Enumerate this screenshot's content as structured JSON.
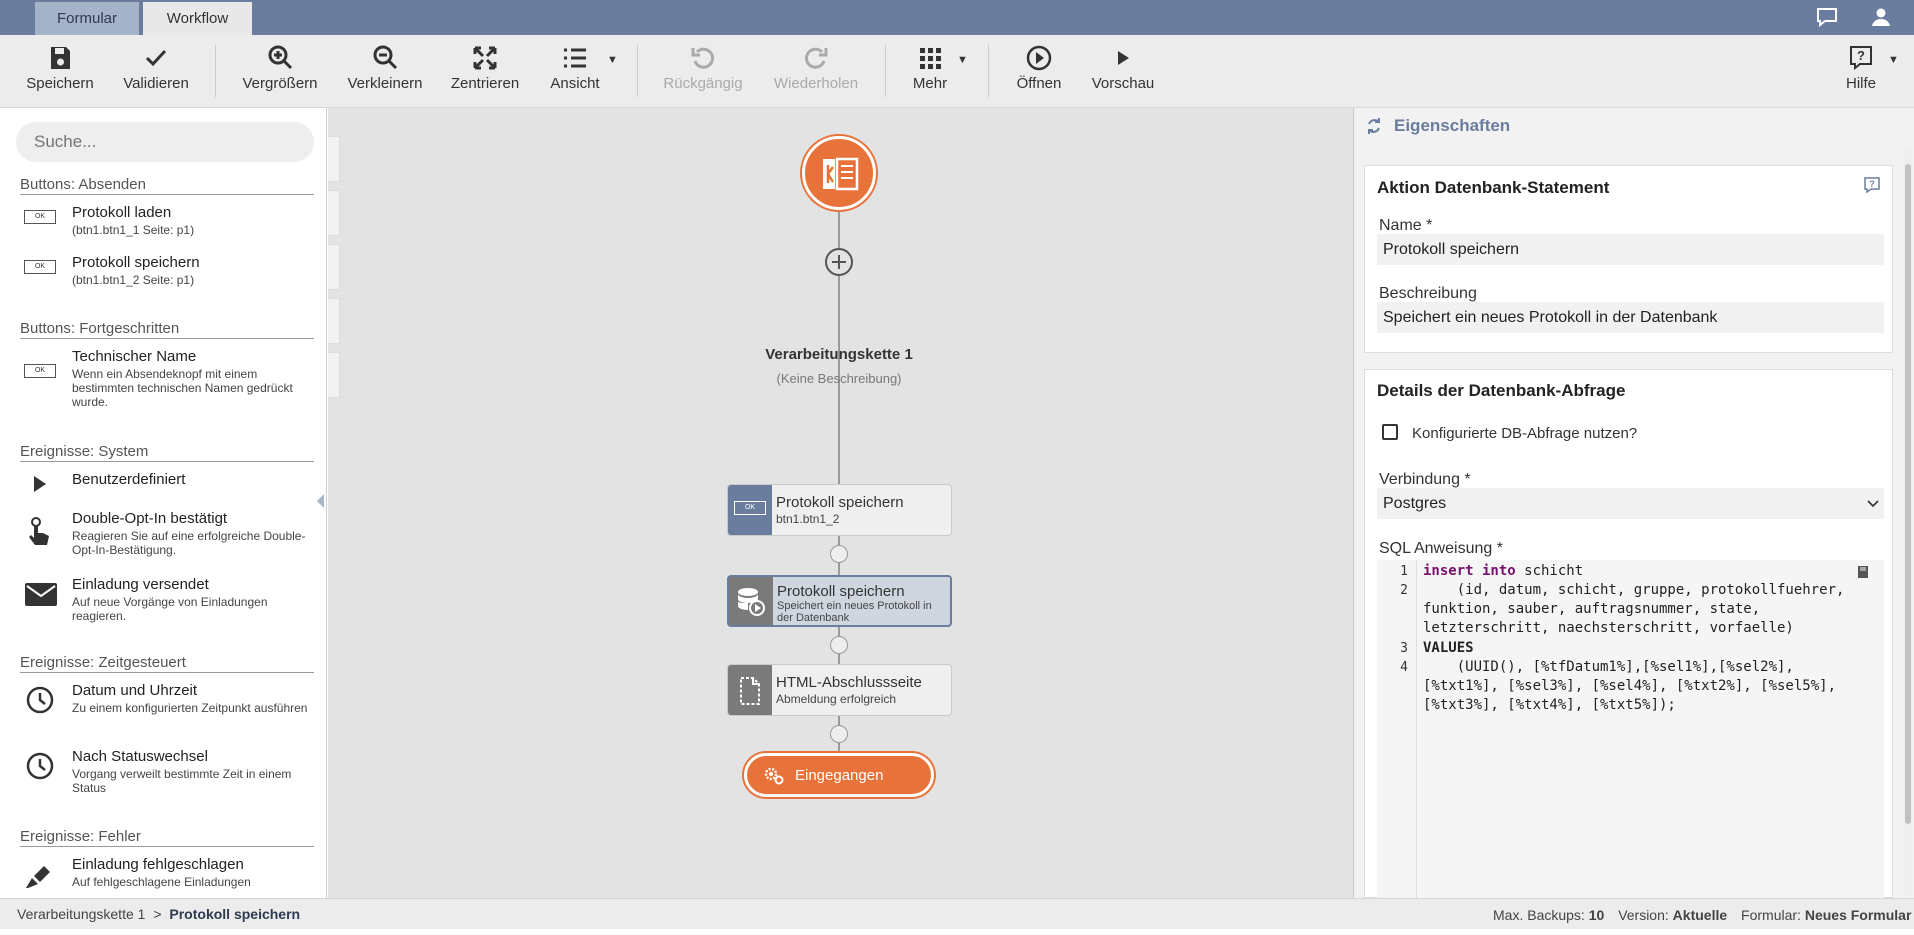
{
  "tabs": [
    {
      "label": "Formular"
    },
    {
      "label": "Workflow"
    }
  ],
  "toolbar": {
    "save": "Speichern",
    "validate": "Validieren",
    "zoom_in": "Vergrößern",
    "zoom_out": "Verkleinern",
    "center": "Zentrieren",
    "view": "Ansicht",
    "undo": "Rückgängig",
    "redo": "Wiederholen",
    "more": "Mehr",
    "open": "Öffnen",
    "preview": "Vorschau",
    "help": "Hilfe"
  },
  "left": {
    "search_placeholder": "Suche...",
    "sections": [
      {
        "title": "Buttons: Absenden"
      },
      {
        "title": "Buttons: Fortgeschritten"
      },
      {
        "title": "Ereignisse: System"
      },
      {
        "title": "Ereignisse: Zeitgesteuert"
      },
      {
        "title": "Ereignisse: Fehler"
      }
    ],
    "items": [
      {
        "title": "Protokoll laden",
        "sub": "(btn1.btn1_1 Seite: p1)",
        "icon": "ok-button-icon"
      },
      {
        "title": "Protokoll speichern",
        "sub": "(btn1.btn1_2 Seite: p1)",
        "icon": "ok-button-icon"
      },
      {
        "title": "Technischer Name",
        "sub": "Wenn ein Absendeknopf mit einem bestimmten technischen Namen gedrückt wurde.",
        "icon": "ok-button-icon"
      },
      {
        "title": "Benutzerdefiniert",
        "sub": "",
        "icon": "play-icon"
      },
      {
        "title": "Double-Opt-In bestätigt",
        "sub": "Reagieren Sie auf eine erfolgreiche Double-Opt-In-Bestätigung.",
        "icon": "hand-pointer-icon"
      },
      {
        "title": "Einladung versendet",
        "sub": "Auf neue Vorgänge von Einladungen reagieren.",
        "icon": "envelope-icon"
      },
      {
        "title": "Datum und Uhrzeit",
        "sub": "Zu einem konfigurierten Zeitpunkt ausführen",
        "icon": "clock-icon"
      },
      {
        "title": "Nach Statuswechsel",
        "sub": "Vorgang verweilt bestimmte Zeit in einem Status",
        "icon": "clock-icon"
      },
      {
        "title": "Einladung fehlgeschlagen",
        "sub": "Auf fehlgeschlagene Einladungen",
        "icon": "pen-icon"
      }
    ]
  },
  "canvas": {
    "chain_title": "Verarbeitungskette 1",
    "chain_desc": "(Keine Beschreibung)",
    "nodes": [
      {
        "title": "Protokoll speichern",
        "sub": "btn1.btn1_2"
      },
      {
        "title": "Protokoll speichern",
        "sub": "Speichert ein neues Protokoll in der Datenbank"
      },
      {
        "title": "HTML-Abschlussseite",
        "sub": "Abmeldung erfolgreich"
      }
    ],
    "end_label": "Eingegangen"
  },
  "right": {
    "header": "Eigenschaften",
    "card1_title": "Aktion Datenbank-Statement",
    "name_label": "Name *",
    "name_value": "Protokoll speichern",
    "desc_label": "Beschreibung",
    "desc_value": "Speichert ein neues Protokoll in der Datenbank",
    "card2_title": "Details der Datenbank-Abfrage",
    "checkbox_label": "Konfigurierte DB-Abfrage nutzen?",
    "conn_label": "Verbindung *",
    "conn_value": "Postgres",
    "sql_label": "SQL Anweisung *",
    "sql": {
      "line_numbers": [
        "1",
        "2",
        "3",
        "4"
      ],
      "l1_kw": "insert into",
      "l1_rest": " schicht",
      "l2a": "    (id, datum, schicht, gruppe, protokollfuehrer,",
      "l2b": "funktion, sauber, auftragsnummer, state,",
      "l2c": "letzterschritt, naechsterschritt, vorfaelle)",
      "l3_kw": "VALUES",
      "l4a": "    (UUID(), [%tfDatum1%],[%sel1%],[%sel2%],",
      "l4b": "[%txt1%], [%sel3%], [%sel4%], [%txt2%], [%sel5%],",
      "l4c": "[%txt3%], [%txt4%], [%txt5%]);"
    }
  },
  "status": {
    "crumb1": "Verarbeitungskette 1",
    "sep": ">",
    "crumb2": "Protokoll speichern",
    "backups_label": "Max. Backups:",
    "backups_value": "10",
    "version_label": "Version:",
    "version_value": "Aktuelle",
    "form_label": "Formular:",
    "form_value": "Neues Formular"
  },
  "colors": {
    "topbar": "#6a7d9f",
    "accent": "#e8733a",
    "node_blue": "#6a7d9f",
    "node_gray": "#7a7a7a"
  }
}
